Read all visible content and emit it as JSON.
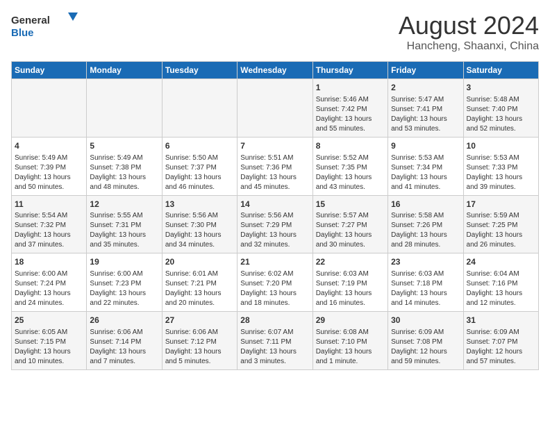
{
  "header": {
    "logo_general": "General",
    "logo_blue": "Blue",
    "main_title": "August 2024",
    "sub_title": "Hancheng, Shaanxi, China"
  },
  "days_of_week": [
    "Sunday",
    "Monday",
    "Tuesday",
    "Wednesday",
    "Thursday",
    "Friday",
    "Saturday"
  ],
  "weeks": [
    [
      {
        "day": "",
        "info": ""
      },
      {
        "day": "",
        "info": ""
      },
      {
        "day": "",
        "info": ""
      },
      {
        "day": "",
        "info": ""
      },
      {
        "day": "1",
        "info": "Sunrise: 5:46 AM\nSunset: 7:42 PM\nDaylight: 13 hours\nand 55 minutes."
      },
      {
        "day": "2",
        "info": "Sunrise: 5:47 AM\nSunset: 7:41 PM\nDaylight: 13 hours\nand 53 minutes."
      },
      {
        "day": "3",
        "info": "Sunrise: 5:48 AM\nSunset: 7:40 PM\nDaylight: 13 hours\nand 52 minutes."
      }
    ],
    [
      {
        "day": "4",
        "info": "Sunrise: 5:49 AM\nSunset: 7:39 PM\nDaylight: 13 hours\nand 50 minutes."
      },
      {
        "day": "5",
        "info": "Sunrise: 5:49 AM\nSunset: 7:38 PM\nDaylight: 13 hours\nand 48 minutes."
      },
      {
        "day": "6",
        "info": "Sunrise: 5:50 AM\nSunset: 7:37 PM\nDaylight: 13 hours\nand 46 minutes."
      },
      {
        "day": "7",
        "info": "Sunrise: 5:51 AM\nSunset: 7:36 PM\nDaylight: 13 hours\nand 45 minutes."
      },
      {
        "day": "8",
        "info": "Sunrise: 5:52 AM\nSunset: 7:35 PM\nDaylight: 13 hours\nand 43 minutes."
      },
      {
        "day": "9",
        "info": "Sunrise: 5:53 AM\nSunset: 7:34 PM\nDaylight: 13 hours\nand 41 minutes."
      },
      {
        "day": "10",
        "info": "Sunrise: 5:53 AM\nSunset: 7:33 PM\nDaylight: 13 hours\nand 39 minutes."
      }
    ],
    [
      {
        "day": "11",
        "info": "Sunrise: 5:54 AM\nSunset: 7:32 PM\nDaylight: 13 hours\nand 37 minutes."
      },
      {
        "day": "12",
        "info": "Sunrise: 5:55 AM\nSunset: 7:31 PM\nDaylight: 13 hours\nand 35 minutes."
      },
      {
        "day": "13",
        "info": "Sunrise: 5:56 AM\nSunset: 7:30 PM\nDaylight: 13 hours\nand 34 minutes."
      },
      {
        "day": "14",
        "info": "Sunrise: 5:56 AM\nSunset: 7:29 PM\nDaylight: 13 hours\nand 32 minutes."
      },
      {
        "day": "15",
        "info": "Sunrise: 5:57 AM\nSunset: 7:27 PM\nDaylight: 13 hours\nand 30 minutes."
      },
      {
        "day": "16",
        "info": "Sunrise: 5:58 AM\nSunset: 7:26 PM\nDaylight: 13 hours\nand 28 minutes."
      },
      {
        "day": "17",
        "info": "Sunrise: 5:59 AM\nSunset: 7:25 PM\nDaylight: 13 hours\nand 26 minutes."
      }
    ],
    [
      {
        "day": "18",
        "info": "Sunrise: 6:00 AM\nSunset: 7:24 PM\nDaylight: 13 hours\nand 24 minutes."
      },
      {
        "day": "19",
        "info": "Sunrise: 6:00 AM\nSunset: 7:23 PM\nDaylight: 13 hours\nand 22 minutes."
      },
      {
        "day": "20",
        "info": "Sunrise: 6:01 AM\nSunset: 7:21 PM\nDaylight: 13 hours\nand 20 minutes."
      },
      {
        "day": "21",
        "info": "Sunrise: 6:02 AM\nSunset: 7:20 PM\nDaylight: 13 hours\nand 18 minutes."
      },
      {
        "day": "22",
        "info": "Sunrise: 6:03 AM\nSunset: 7:19 PM\nDaylight: 13 hours\nand 16 minutes."
      },
      {
        "day": "23",
        "info": "Sunrise: 6:03 AM\nSunset: 7:18 PM\nDaylight: 13 hours\nand 14 minutes."
      },
      {
        "day": "24",
        "info": "Sunrise: 6:04 AM\nSunset: 7:16 PM\nDaylight: 13 hours\nand 12 minutes."
      }
    ],
    [
      {
        "day": "25",
        "info": "Sunrise: 6:05 AM\nSunset: 7:15 PM\nDaylight: 13 hours\nand 10 minutes."
      },
      {
        "day": "26",
        "info": "Sunrise: 6:06 AM\nSunset: 7:14 PM\nDaylight: 13 hours\nand 7 minutes."
      },
      {
        "day": "27",
        "info": "Sunrise: 6:06 AM\nSunset: 7:12 PM\nDaylight: 13 hours\nand 5 minutes."
      },
      {
        "day": "28",
        "info": "Sunrise: 6:07 AM\nSunset: 7:11 PM\nDaylight: 13 hours\nand 3 minutes."
      },
      {
        "day": "29",
        "info": "Sunrise: 6:08 AM\nSunset: 7:10 PM\nDaylight: 13 hours\nand 1 minute."
      },
      {
        "day": "30",
        "info": "Sunrise: 6:09 AM\nSunset: 7:08 PM\nDaylight: 12 hours\nand 59 minutes."
      },
      {
        "day": "31",
        "info": "Sunrise: 6:09 AM\nSunset: 7:07 PM\nDaylight: 12 hours\nand 57 minutes."
      }
    ]
  ]
}
